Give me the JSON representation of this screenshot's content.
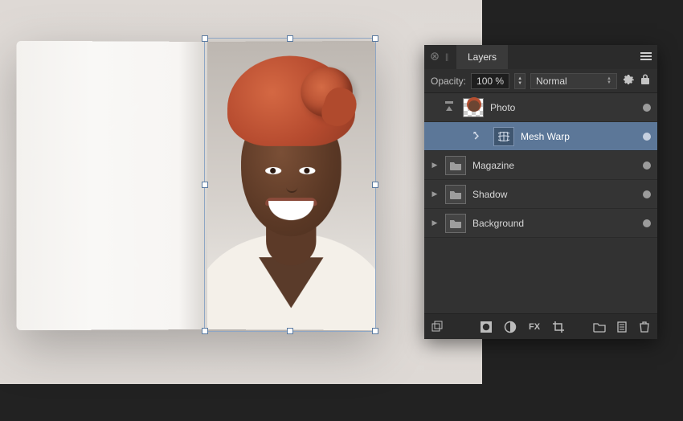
{
  "panel": {
    "title": "Layers",
    "opacity_label": "Opacity:",
    "opacity_value": "100 %",
    "blend_mode": "Normal"
  },
  "layers": [
    {
      "name": "Photo",
      "kind": "image",
      "selected": false,
      "expanded": true
    },
    {
      "name": "Mesh Warp",
      "kind": "filter",
      "selected": true,
      "expanded": false
    },
    {
      "name": "Magazine",
      "kind": "group",
      "selected": false,
      "expanded": false
    },
    {
      "name": "Shadow",
      "kind": "group",
      "selected": false,
      "expanded": false
    },
    {
      "name": "Background",
      "kind": "group",
      "selected": false,
      "expanded": false
    }
  ]
}
